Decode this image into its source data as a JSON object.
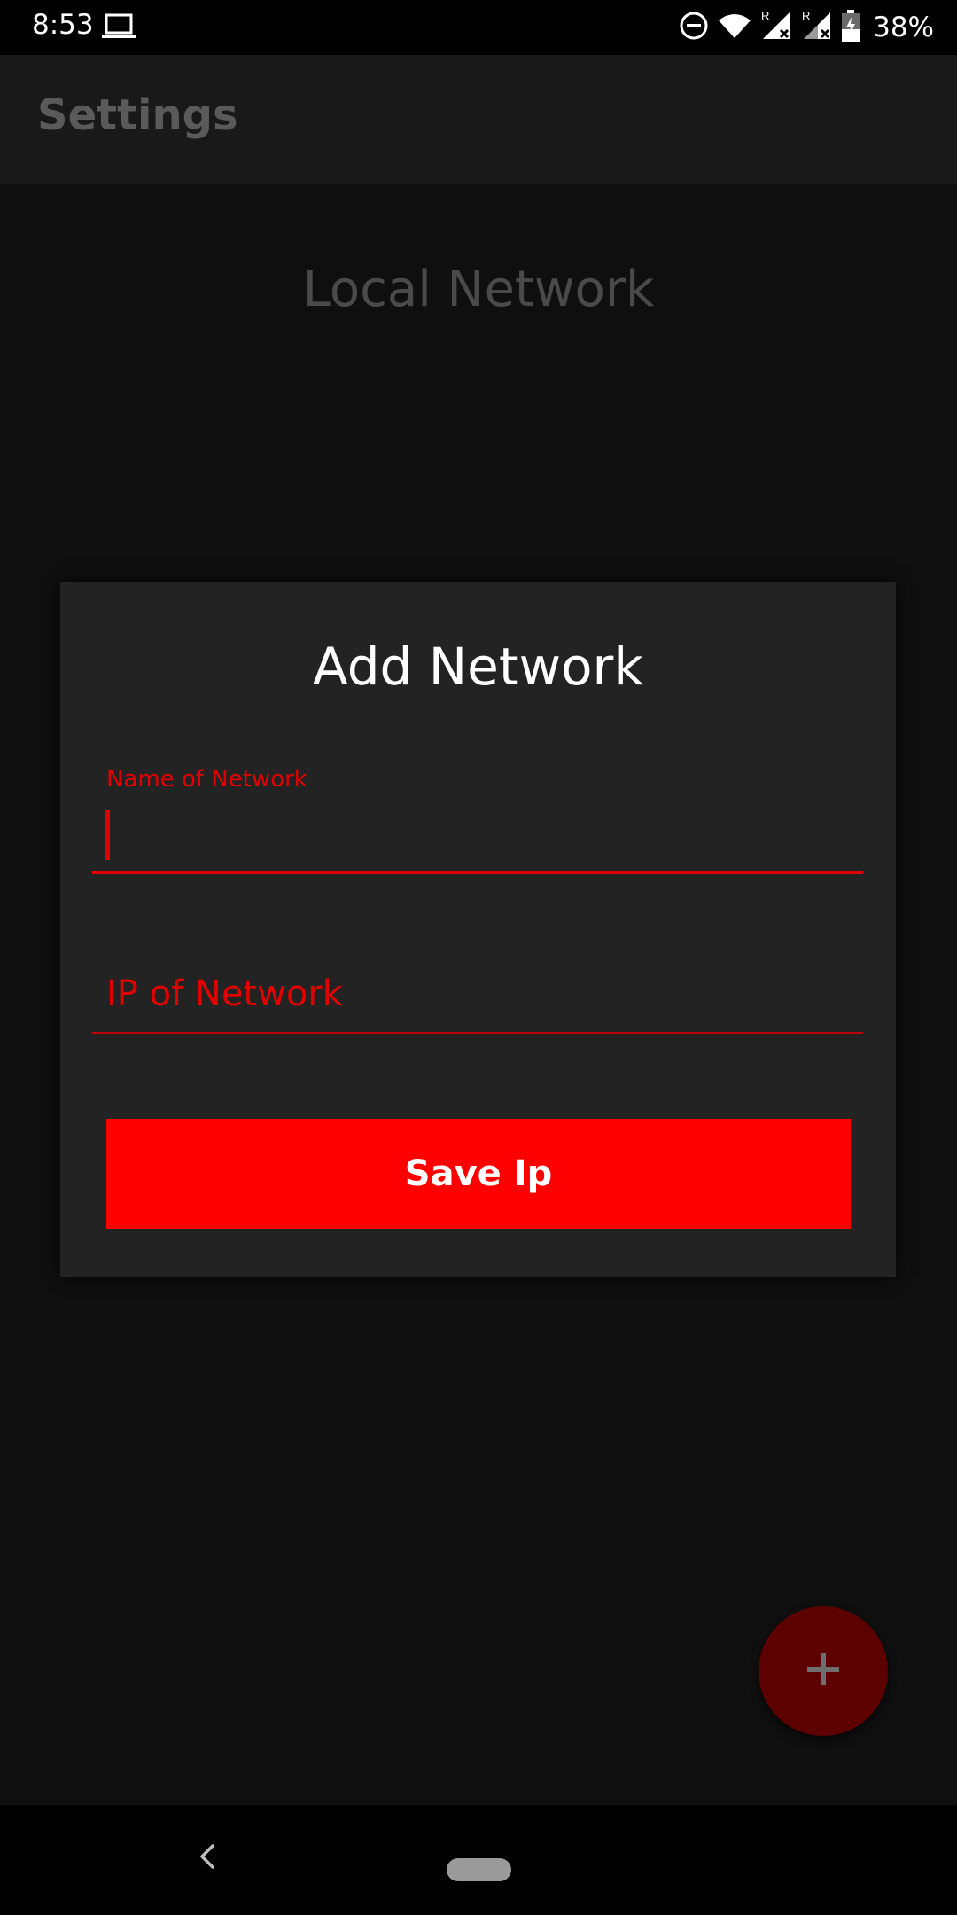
{
  "status_bar": {
    "time": "8:53",
    "battery_percent": "38%",
    "icons": [
      "laptop-icon",
      "dnd-icon",
      "wifi-icon",
      "signal-roaming-icon",
      "signal-roaming-icon",
      "battery-charging-icon"
    ],
    "roaming_label": "R"
  },
  "app_bar": {
    "title": "Settings"
  },
  "content": {
    "section_heading": "Local Network"
  },
  "dialog": {
    "title": "Add Network",
    "name_field": {
      "label": "Name of Network",
      "value": ""
    },
    "ip_field": {
      "placeholder": "IP of Network",
      "value": ""
    },
    "save_button_label": "Save Ip"
  },
  "fab": {
    "icon": "plus-icon",
    "color": "#5c0000"
  },
  "nav_bar": {
    "icons": [
      "back-icon",
      "home-pill-icon"
    ]
  },
  "colors": {
    "accent": "#ff0000",
    "dialog_bg": "#232323",
    "app_bar_bg": "#191919",
    "content_bg": "#0f0f0f"
  }
}
